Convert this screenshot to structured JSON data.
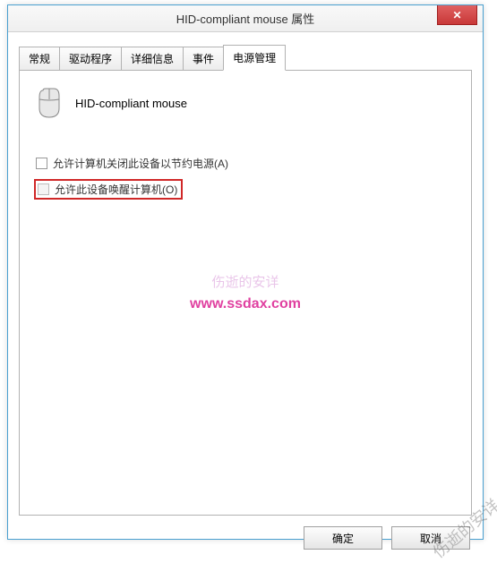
{
  "window": {
    "title": "HID-compliant mouse 属性",
    "close_symbol": "✕"
  },
  "tabs": {
    "general": "常规",
    "driver": "驱动程序",
    "details": "详细信息",
    "events": "事件",
    "power": "电源管理"
  },
  "device": {
    "name": "HID-compliant mouse"
  },
  "options": {
    "allow_off": "允许计算机关闭此设备以节约电源(A)",
    "allow_wake": "允许此设备唤醒计算机(O)"
  },
  "watermark": {
    "line1": "伤逝的安详",
    "line2": "www.ssdax.com",
    "diag": "伤逝的安详"
  },
  "buttons": {
    "ok": "确定",
    "cancel": "取消"
  }
}
